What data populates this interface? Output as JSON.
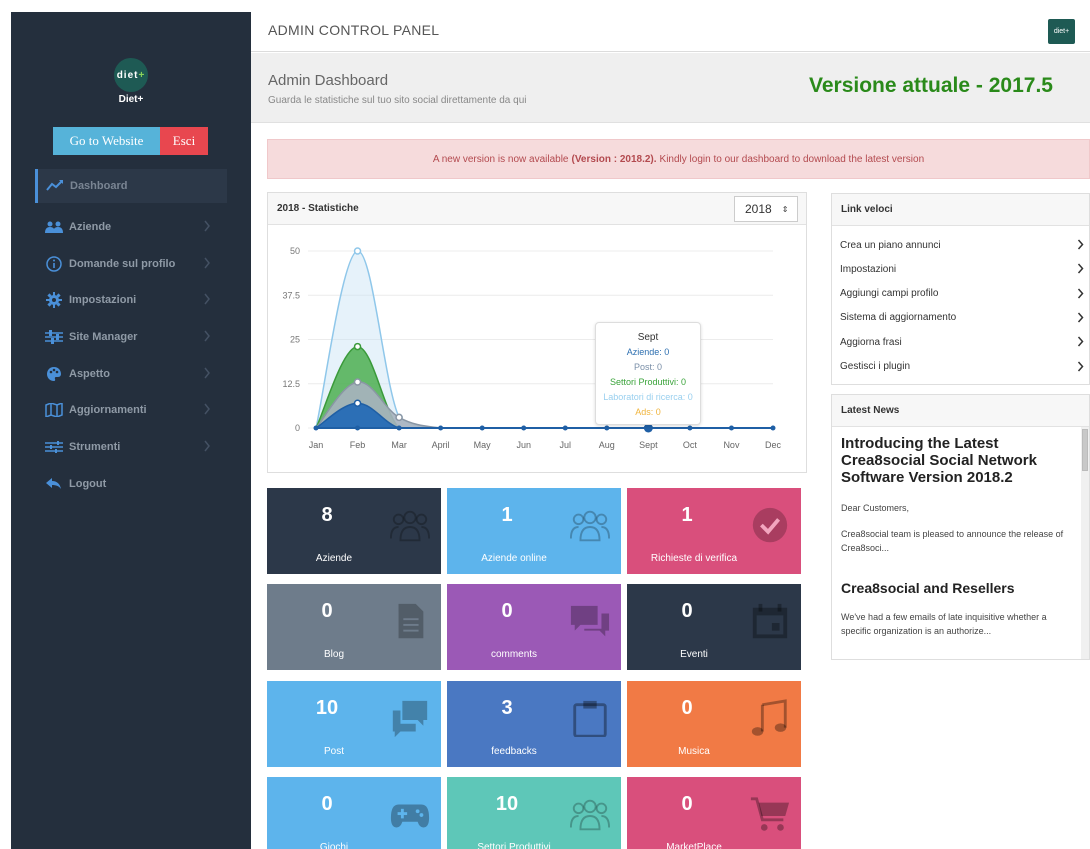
{
  "colors": {
    "sidebar_bg": "#242f3d",
    "accent_green": "#2a8a1a",
    "alert_text": "#b34a4f"
  },
  "sidebar": {
    "logo_text": "diet",
    "logo_plus": "+",
    "brand": "Diet+",
    "website_button": "Go to Website",
    "logout_button": "Esci",
    "items": [
      {
        "label": "Dashboard",
        "icon": "chart-line-icon",
        "active": true
      },
      {
        "label": "Aziende",
        "icon": "users-icon",
        "chevron": true
      },
      {
        "label": "Domande sul profilo",
        "icon": "info-circle-icon",
        "chevron": true
      },
      {
        "label": "Impostazioni",
        "icon": "gear-icon",
        "chevron": true
      },
      {
        "label": "Site Manager",
        "icon": "sliders-icon",
        "chevron": true
      },
      {
        "label": "Aspetto",
        "icon": "palette-icon",
        "chevron": true
      },
      {
        "label": "Aggiornamenti",
        "icon": "map-icon",
        "chevron": true
      },
      {
        "label": "Strumenti",
        "icon": "tools-icon",
        "chevron": true
      },
      {
        "label": "Logout",
        "icon": "reply-icon"
      }
    ]
  },
  "header": {
    "title": "ADMIN CONTROL PANEL",
    "logo_text": "diet+"
  },
  "subheader": {
    "title": "Admin Dashboard",
    "description": "Guarda le statistiche sul tuo sito social direttamente da qui",
    "version": "Versione attuale - 2017.5"
  },
  "alert": {
    "before": "A new version is now available",
    "bold": "(Version : 2018.2).",
    "after": "Kindly login to our dashboard to download the latest version"
  },
  "stats": {
    "title": "2018 - Statistiche",
    "year": "2018",
    "year_arrow": "⇕",
    "tooltip": {
      "title": "Sept",
      "lines": [
        {
          "text": "Aziende: 0",
          "color": "#2d6fb0"
        },
        {
          "text": "Post: 0",
          "color": "#7a8fa8"
        },
        {
          "text": "Settori Produttivi: 0",
          "color": "#3aa33a"
        },
        {
          "text": "Laboratori di ricerca: 0",
          "color": "#9ad0ef"
        },
        {
          "text": "Ads: 0",
          "color": "#f0b43c"
        }
      ]
    }
  },
  "chart_data": {
    "type": "area",
    "categories": [
      "Jan",
      "Feb",
      "Mar",
      "April",
      "May",
      "Jun",
      "Jul",
      "Aug",
      "Sept",
      "Oct",
      "Nov",
      "Dec"
    ],
    "ylim": [
      0,
      50
    ],
    "yticks": [
      "0",
      "12.5",
      "25",
      "37.5",
      "50"
    ],
    "grid": true,
    "series": [
      {
        "name": "Laboratori di ricerca",
        "color": "#c7e3f5",
        "values": [
          0,
          50,
          3,
          0,
          0,
          0,
          0,
          0,
          0,
          0,
          0,
          0
        ]
      },
      {
        "name": "Settori Produttivi",
        "color": "#4caf50",
        "values": [
          0,
          23,
          0,
          0,
          0,
          0,
          0,
          0,
          0,
          0,
          0,
          0
        ]
      },
      {
        "name": "Post",
        "color": "#a7b2bf",
        "values": [
          0,
          13,
          3,
          0,
          0,
          0,
          0,
          0,
          0,
          0,
          0,
          0
        ]
      },
      {
        "name": "Aziende",
        "color": "#2c6fb6",
        "values": [
          0,
          7,
          0,
          0,
          0,
          0,
          0,
          0,
          0,
          0,
          0,
          0
        ]
      },
      {
        "name": "Ads",
        "color": "#f0b43c",
        "values": [
          0,
          0,
          0,
          0,
          0,
          0,
          0,
          0,
          0,
          0,
          0,
          0
        ]
      }
    ]
  },
  "links": {
    "title": "Link veloci",
    "items": [
      "Crea un piano annunci",
      "Impostazioni",
      "Aggiungi campi profilo",
      "Sistema di aggiornamento",
      "Aggiorna frasi",
      "Gestisci i plugin"
    ]
  },
  "news": {
    "title": "Latest News",
    "article1_title": "Introducing the Latest Crea8social Social Network Software Version 2018.2",
    "article1_greeting": "Dear Customers,",
    "article1_excerpt": "Crea8social team is pleased to announce the release of Crea8soci...",
    "article2_title": "Crea8social and Resellers",
    "article2_excerpt": "We've had a few emails of late inquisitive whether a specific organization is an authorize..."
  },
  "tiles": [
    {
      "value": "8",
      "label": "Aziende",
      "color": "#2c3849",
      "icon": "users-icon"
    },
    {
      "value": "1",
      "label": "Aziende online",
      "color": "#5db4ec",
      "icon": "users-icon"
    },
    {
      "value": "1",
      "label": "Richieste di verifica",
      "color": "#d94f7c",
      "icon": "check-circle-icon"
    },
    {
      "value": "0",
      "label": "Blog",
      "color": "#6e7c8b",
      "icon": "document-icon"
    },
    {
      "value": "0",
      "label": "comments",
      "color": "#9b59b6",
      "icon": "comments-icon"
    },
    {
      "value": "0",
      "label": "Eventi",
      "color": "#2c3849",
      "icon": "calendar-icon"
    },
    {
      "value": "10",
      "label": "Post",
      "color": "#5db4ec",
      "icon": "chat-icon"
    },
    {
      "value": "3",
      "label": "feedbacks",
      "color": "#4a78c2",
      "icon": "clipboard-icon"
    },
    {
      "value": "0",
      "label": "Musica",
      "color": "#f17a45",
      "icon": "music-icon"
    },
    {
      "value": "0",
      "label": "Giochi",
      "color": "#5db4ec",
      "icon": "gamepad-icon"
    },
    {
      "value": "10",
      "label": "Settori Produttivi",
      "color": "#5ec7b8",
      "icon": "users-icon"
    },
    {
      "value": "0",
      "label": "MarketPlace",
      "color": "#d94f7c",
      "icon": "cart-icon"
    }
  ]
}
